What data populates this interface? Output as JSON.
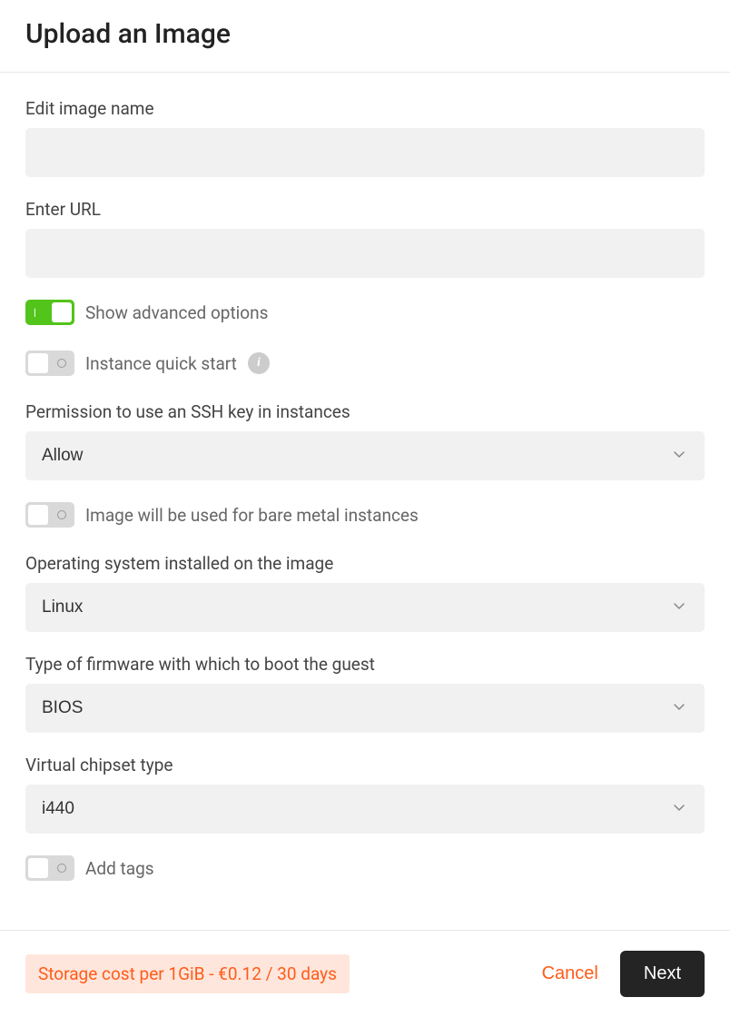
{
  "header": {
    "title": "Upload an Image"
  },
  "fields": {
    "image_name": {
      "label": "Edit image name",
      "value": ""
    },
    "url": {
      "label": "Enter URL",
      "value": ""
    },
    "advanced": {
      "label": "Show advanced options"
    },
    "quick_start": {
      "label": "Instance quick start"
    },
    "ssh_permission": {
      "label": "Permission to use an SSH key in instances",
      "value": "Allow"
    },
    "bare_metal": {
      "label": "Image will be used for bare metal instances"
    },
    "os": {
      "label": "Operating system installed on the image",
      "value": "Linux"
    },
    "firmware": {
      "label": "Type of firmware with which to boot the guest",
      "value": "BIOS"
    },
    "chipset": {
      "label": "Virtual chipset type",
      "value": "i440"
    },
    "tags": {
      "label": "Add tags"
    }
  },
  "footer": {
    "storage_cost": "Storage cost per 1GiB - €0.12 / 30 days",
    "cancel": "Cancel",
    "next": "Next"
  }
}
